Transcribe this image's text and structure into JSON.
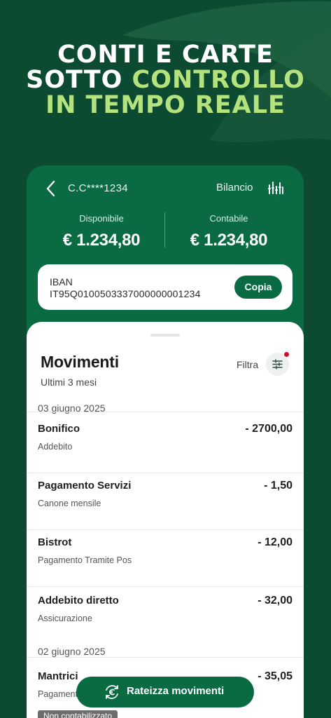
{
  "headline": {
    "line1": "CONTI E CARTE",
    "line2_white": "SOTTO ",
    "line2_accent": "CONTROLLO",
    "line3_accent": "IN TEMPO REALE"
  },
  "account": {
    "number": "C.C****1234",
    "bilancio_label": "Bilancio",
    "balances": [
      {
        "label": "Disponibile",
        "amount": "€ 1.234,80"
      },
      {
        "label": "Contabile",
        "amount": "€ 1.234,80"
      }
    ],
    "iban_label": "IBAN",
    "iban_value": "IT95Q0100503337000000001234",
    "copy_label": "Copia"
  },
  "movements": {
    "title": "Movimenti",
    "subtitle": "Ultimi 3 mesi",
    "filter_label": "Filtra",
    "groups": [
      {
        "date": "03 giugno 2025",
        "items": [
          {
            "title": "Bonifico",
            "desc": "Addebito",
            "amount": "- 2700,00"
          },
          {
            "title": "Pagamento Servizi",
            "desc": "Canone mensile",
            "amount": "- 1,50"
          },
          {
            "title": "Bistrot",
            "desc": "Pagamento Tramite Pos",
            "amount": "- 12,00"
          },
          {
            "title": "Addebito diretto",
            "desc": "Assicurazione",
            "amount": "- 32,00"
          }
        ]
      },
      {
        "date": "02 giugno 2025",
        "items": [
          {
            "title": "Mantrici",
            "desc": "Pagamento",
            "amount": "- 35,05",
            "badge": "Non contabilizzato"
          }
        ]
      }
    ]
  },
  "fab": {
    "label": "Rateizza movimenti",
    "icon": "euro-refresh-icon"
  },
  "colors": {
    "background": "#0d4a32",
    "card": "#0a6a42",
    "accent": "#b4e27c",
    "alert_dot": "#c8102e"
  }
}
